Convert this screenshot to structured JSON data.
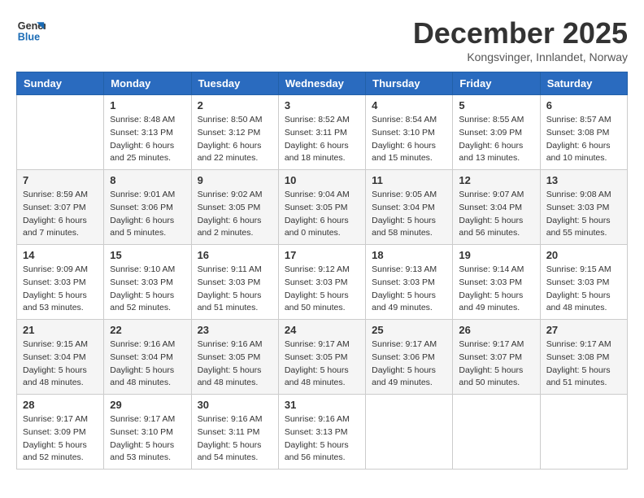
{
  "header": {
    "logo_line1": "General",
    "logo_line2": "Blue",
    "month_title": "December 2025",
    "location": "Kongsvinger, Innlandet, Norway"
  },
  "weekdays": [
    "Sunday",
    "Monday",
    "Tuesday",
    "Wednesday",
    "Thursday",
    "Friday",
    "Saturday"
  ],
  "weeks": [
    [
      {
        "day": "",
        "info": ""
      },
      {
        "day": "1",
        "info": "Sunrise: 8:48 AM\nSunset: 3:13 PM\nDaylight: 6 hours\nand 25 minutes."
      },
      {
        "day": "2",
        "info": "Sunrise: 8:50 AM\nSunset: 3:12 PM\nDaylight: 6 hours\nand 22 minutes."
      },
      {
        "day": "3",
        "info": "Sunrise: 8:52 AM\nSunset: 3:11 PM\nDaylight: 6 hours\nand 18 minutes."
      },
      {
        "day": "4",
        "info": "Sunrise: 8:54 AM\nSunset: 3:10 PM\nDaylight: 6 hours\nand 15 minutes."
      },
      {
        "day": "5",
        "info": "Sunrise: 8:55 AM\nSunset: 3:09 PM\nDaylight: 6 hours\nand 13 minutes."
      },
      {
        "day": "6",
        "info": "Sunrise: 8:57 AM\nSunset: 3:08 PM\nDaylight: 6 hours\nand 10 minutes."
      }
    ],
    [
      {
        "day": "7",
        "info": "Sunrise: 8:59 AM\nSunset: 3:07 PM\nDaylight: 6 hours\nand 7 minutes."
      },
      {
        "day": "8",
        "info": "Sunrise: 9:01 AM\nSunset: 3:06 PM\nDaylight: 6 hours\nand 5 minutes."
      },
      {
        "day": "9",
        "info": "Sunrise: 9:02 AM\nSunset: 3:05 PM\nDaylight: 6 hours\nand 2 minutes."
      },
      {
        "day": "10",
        "info": "Sunrise: 9:04 AM\nSunset: 3:05 PM\nDaylight: 6 hours\nand 0 minutes."
      },
      {
        "day": "11",
        "info": "Sunrise: 9:05 AM\nSunset: 3:04 PM\nDaylight: 5 hours\nand 58 minutes."
      },
      {
        "day": "12",
        "info": "Sunrise: 9:07 AM\nSunset: 3:04 PM\nDaylight: 5 hours\nand 56 minutes."
      },
      {
        "day": "13",
        "info": "Sunrise: 9:08 AM\nSunset: 3:03 PM\nDaylight: 5 hours\nand 55 minutes."
      }
    ],
    [
      {
        "day": "14",
        "info": "Sunrise: 9:09 AM\nSunset: 3:03 PM\nDaylight: 5 hours\nand 53 minutes."
      },
      {
        "day": "15",
        "info": "Sunrise: 9:10 AM\nSunset: 3:03 PM\nDaylight: 5 hours\nand 52 minutes."
      },
      {
        "day": "16",
        "info": "Sunrise: 9:11 AM\nSunset: 3:03 PM\nDaylight: 5 hours\nand 51 minutes."
      },
      {
        "day": "17",
        "info": "Sunrise: 9:12 AM\nSunset: 3:03 PM\nDaylight: 5 hours\nand 50 minutes."
      },
      {
        "day": "18",
        "info": "Sunrise: 9:13 AM\nSunset: 3:03 PM\nDaylight: 5 hours\nand 49 minutes."
      },
      {
        "day": "19",
        "info": "Sunrise: 9:14 AM\nSunset: 3:03 PM\nDaylight: 5 hours\nand 49 minutes."
      },
      {
        "day": "20",
        "info": "Sunrise: 9:15 AM\nSunset: 3:03 PM\nDaylight: 5 hours\nand 48 minutes."
      }
    ],
    [
      {
        "day": "21",
        "info": "Sunrise: 9:15 AM\nSunset: 3:04 PM\nDaylight: 5 hours\nand 48 minutes."
      },
      {
        "day": "22",
        "info": "Sunrise: 9:16 AM\nSunset: 3:04 PM\nDaylight: 5 hours\nand 48 minutes."
      },
      {
        "day": "23",
        "info": "Sunrise: 9:16 AM\nSunset: 3:05 PM\nDaylight: 5 hours\nand 48 minutes."
      },
      {
        "day": "24",
        "info": "Sunrise: 9:17 AM\nSunset: 3:05 PM\nDaylight: 5 hours\nand 48 minutes."
      },
      {
        "day": "25",
        "info": "Sunrise: 9:17 AM\nSunset: 3:06 PM\nDaylight: 5 hours\nand 49 minutes."
      },
      {
        "day": "26",
        "info": "Sunrise: 9:17 AM\nSunset: 3:07 PM\nDaylight: 5 hours\nand 50 minutes."
      },
      {
        "day": "27",
        "info": "Sunrise: 9:17 AM\nSunset: 3:08 PM\nDaylight: 5 hours\nand 51 minutes."
      }
    ],
    [
      {
        "day": "28",
        "info": "Sunrise: 9:17 AM\nSunset: 3:09 PM\nDaylight: 5 hours\nand 52 minutes."
      },
      {
        "day": "29",
        "info": "Sunrise: 9:17 AM\nSunset: 3:10 PM\nDaylight: 5 hours\nand 53 minutes."
      },
      {
        "day": "30",
        "info": "Sunrise: 9:16 AM\nSunset: 3:11 PM\nDaylight: 5 hours\nand 54 minutes."
      },
      {
        "day": "31",
        "info": "Sunrise: 9:16 AM\nSunset: 3:13 PM\nDaylight: 5 hours\nand 56 minutes."
      },
      {
        "day": "",
        "info": ""
      },
      {
        "day": "",
        "info": ""
      },
      {
        "day": "",
        "info": ""
      }
    ]
  ]
}
